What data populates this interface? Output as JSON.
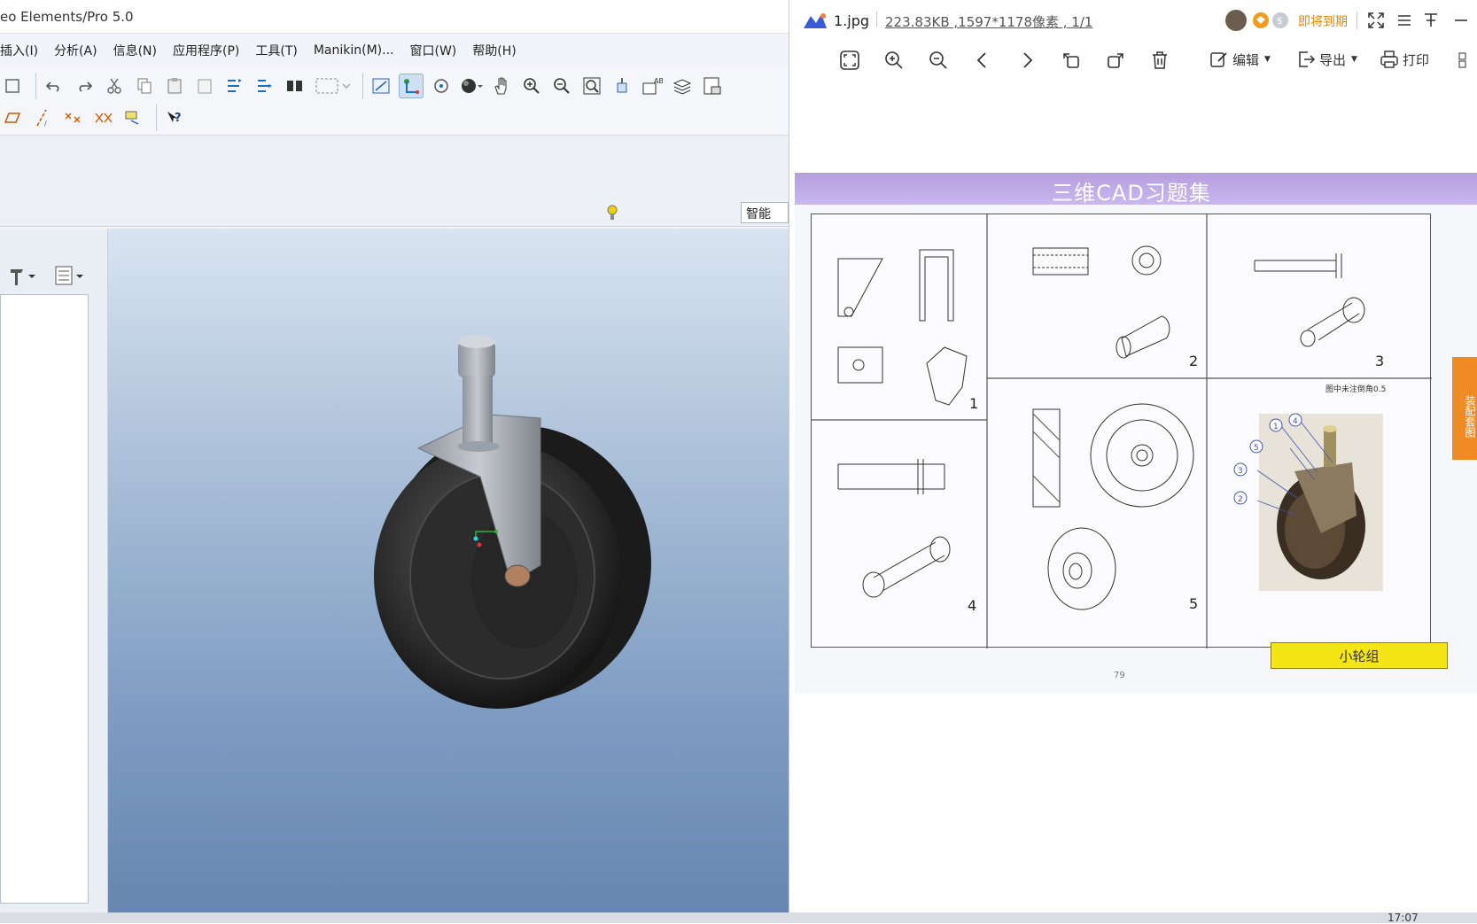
{
  "creo": {
    "title": "eo Elements/Pro 5.0",
    "menu": [
      "插入(I)",
      "分析(A)",
      "信息(N)",
      "应用程序(P)",
      "工具(T)",
      "Manikin(M)...",
      "窗口(W)",
      "帮助(H)"
    ],
    "smart_filter": "智能"
  },
  "viewer": {
    "file_name": "1.jpg",
    "file_info": "223.83KB ,1597*1178像素 , 1/1",
    "expire_label": "即将到期",
    "toolbar": {
      "edit_label": "编辑",
      "export_label": "导出",
      "print_label": "打印"
    },
    "page": {
      "book_title": "三维CAD习题集",
      "cell_numbers": [
        "1",
        "2",
        "3",
        "4",
        "5"
      ],
      "note": "图中未注倒角0.5",
      "side_tab": "装配套图",
      "caption": "小轮组",
      "page_number": "79",
      "balloons": [
        "1",
        "4",
        "5",
        "3",
        "2"
      ]
    }
  },
  "system": {
    "clock": "17:07"
  },
  "colors": {
    "viewport_top": "#d9e4f1",
    "viewport_bottom": "#6786b0",
    "book_header": "#b59ee0",
    "caption_fill": "#f4e516",
    "side_tab": "#f08a24",
    "expire_text": "#e08a00"
  }
}
